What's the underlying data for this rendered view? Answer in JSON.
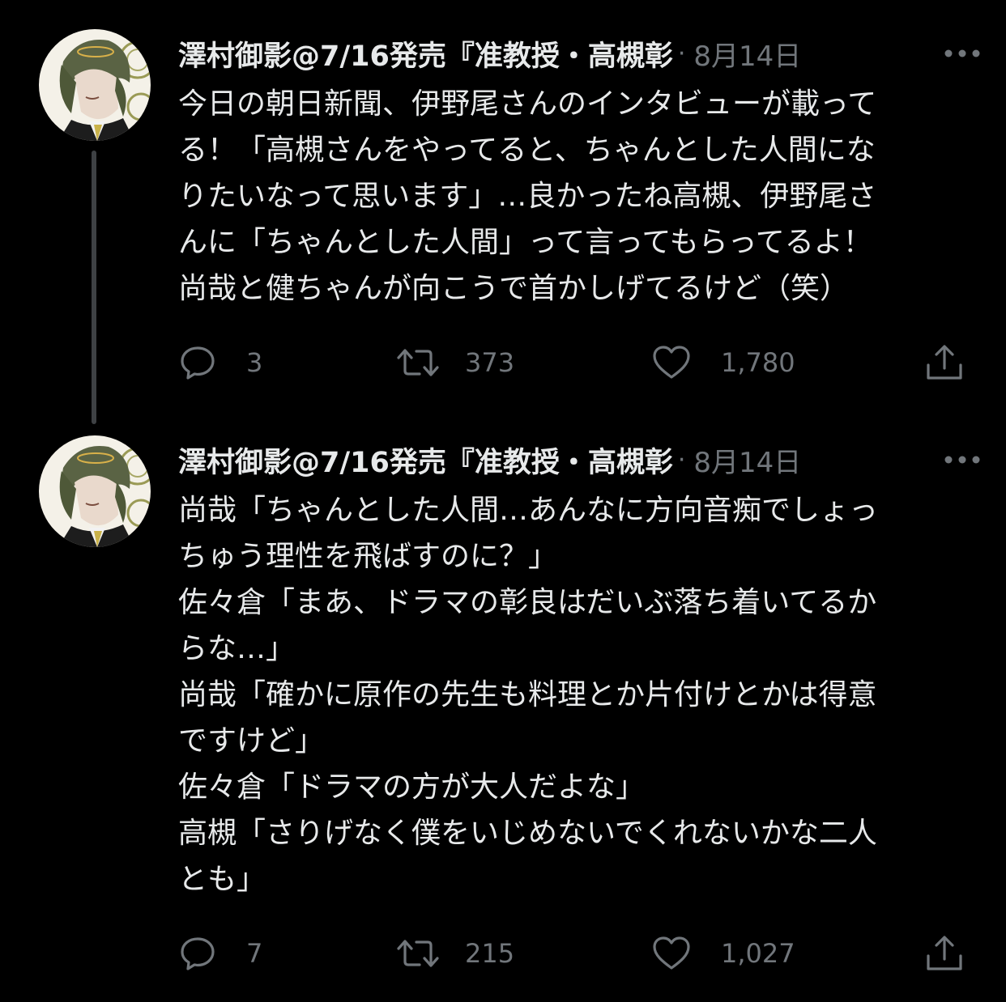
{
  "tweets": [
    {
      "display_name": "澤村御影@7/16発売『准教授・高槻彰",
      "separator": "·",
      "date": "8月14日",
      "lines": [
        "今日の朝日新聞、伊野尾さんのインタビューが載って",
        "る！「高槻さんをやってると、ちゃんとした人間にな",
        "りたいなって思います」…良かったね高槻、伊野尾さ",
        "んに「ちゃんとした人間」って言ってもらってるよ！",
        "尚哉と健ちゃんが向こうで首かしげてるけど（笑）"
      ],
      "replies": "3",
      "retweets": "373",
      "likes": "1,780"
    },
    {
      "display_name": "澤村御影@7/16発売『准教授・高槻彰",
      "separator": "·",
      "date": "8月14日",
      "lines": [
        "尚哉「ちゃんとした人間…あんなに方向音痴でしょっ",
        "ちゅう理性を飛ばすのに？」",
        "佐々倉「まあ、ドラマの彰良はだいぶ落ち着いてるか",
        "らな…」",
        "尚哉「確かに原作の先生も料理とか片付けとかは得意",
        "ですけど」",
        "佐々倉「ドラマの方が大人だよな」",
        "高槻「さりげなく僕をいじめないでくれないかな二人",
        "とも」"
      ],
      "replies": "7",
      "retweets": "215",
      "likes": "1,027"
    }
  ],
  "icons": {
    "more": "more-horizontal-icon",
    "reply": "reply-bubble-icon",
    "retweet": "retweet-arrows-icon",
    "like": "heart-icon",
    "share": "share-upload-icon"
  },
  "colors": {
    "background": "#000000",
    "text": "#e7e9ea",
    "muted": "#71767b",
    "thread_line": "#3e4144"
  }
}
